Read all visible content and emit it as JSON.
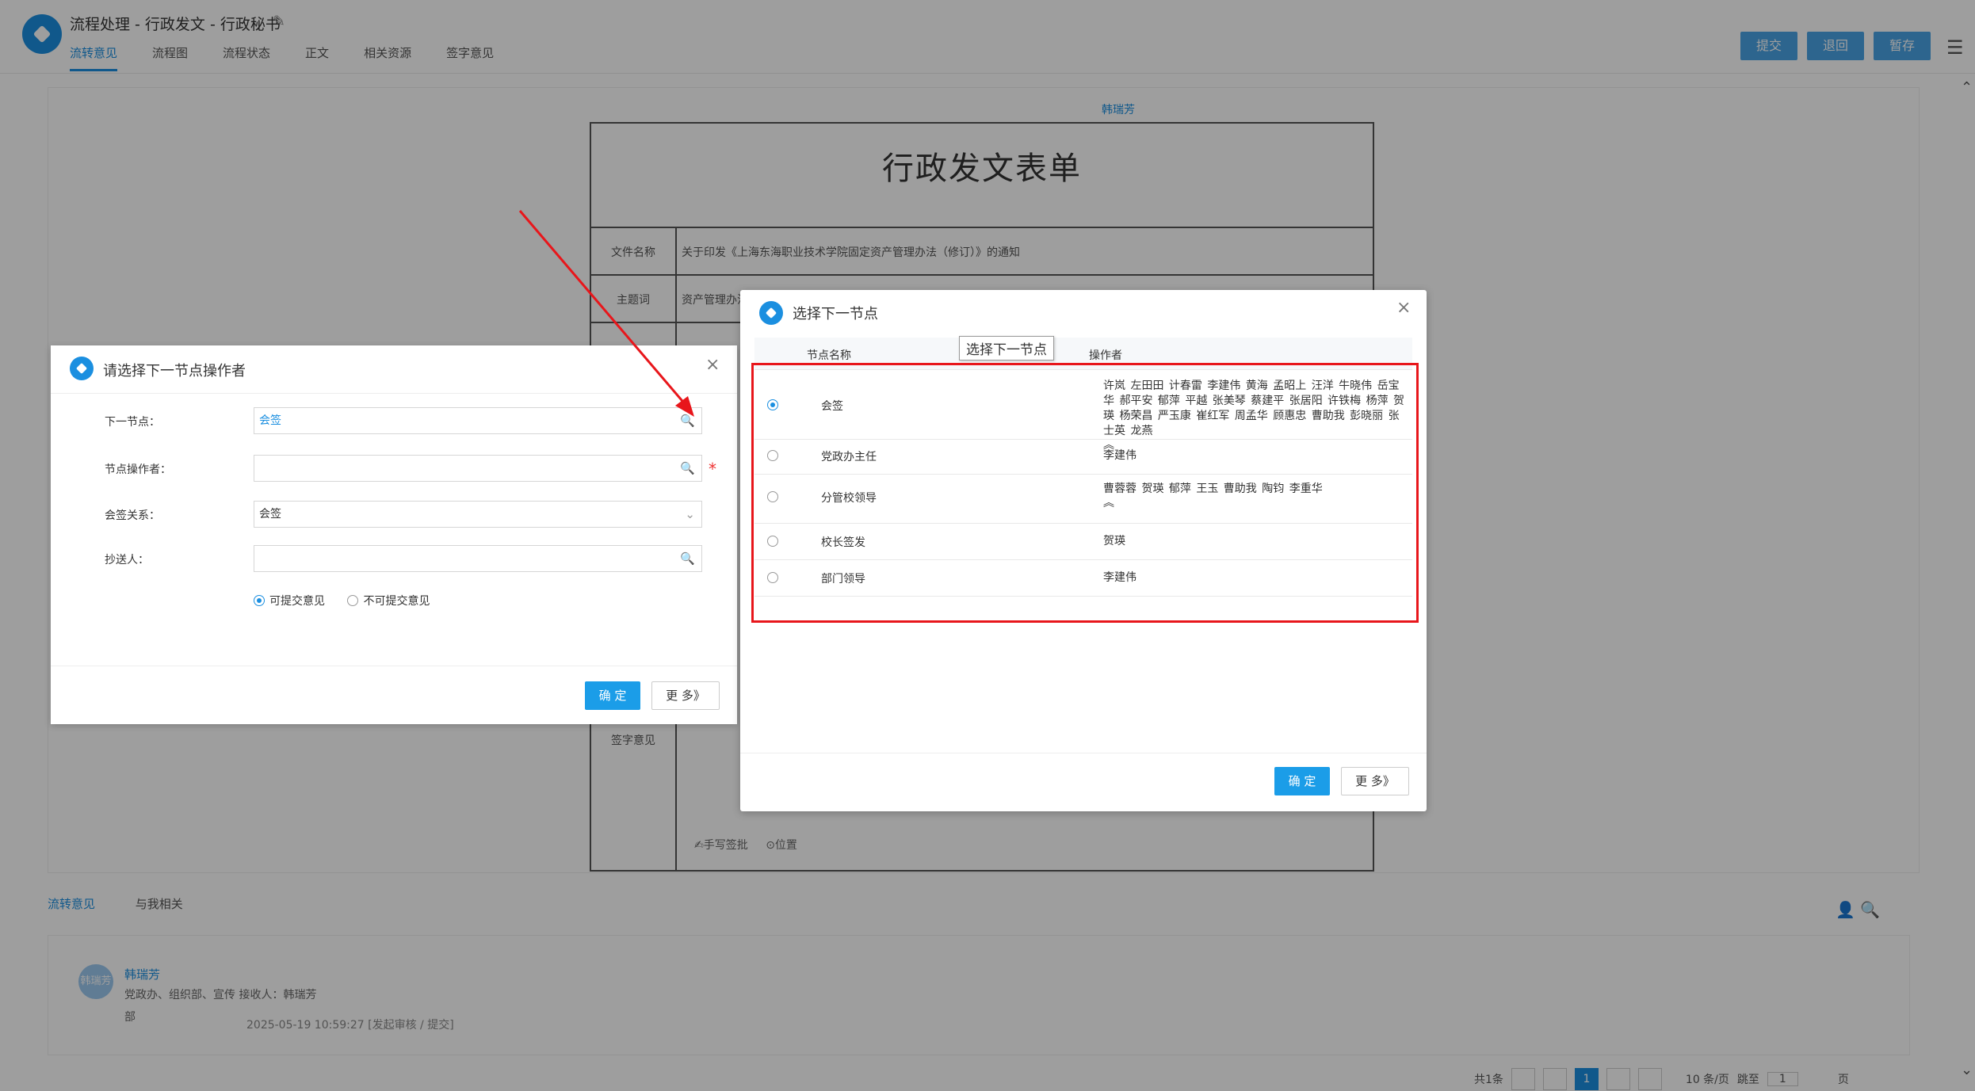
{
  "header": {
    "title": "流程处理 - 行政发文 - 行政秘书",
    "tabs": [
      "流转意见",
      "流程图",
      "流程状态",
      "正文",
      "相关资源",
      "签字意见"
    ],
    "buttons": [
      "提交",
      "退回",
      "暂存"
    ]
  },
  "document": {
    "author": "韩瑞芳",
    "form_title": "行政发文表单",
    "fields": [
      {
        "label": "文件名称",
        "value": "关于印发《上海东海职业技术学院固定资产管理办法（修订）》的通知"
      },
      {
        "label": "主题词",
        "value": "资产管理办法"
      },
      {
        "label": "签字意见",
        "value": ""
      }
    ],
    "signature_tools": [
      "手写签批",
      "位置"
    ]
  },
  "bottom": {
    "tabs": [
      "流转意见",
      "与我相关"
    ],
    "comment": {
      "avatar": "韩瑞芳",
      "name": "韩瑞芳",
      "meta": "党政办、组织部、宣传  接收人：韩瑞芳",
      "meta2": "部",
      "time": "2025-05-19 10:59:27  [发起审核 / 提交]"
    },
    "pager": {
      "total": "共1条",
      "current": "1",
      "per_page": "10 条/页",
      "goto_label": "跳至",
      "goto_value": "1",
      "page_unit": "页"
    }
  },
  "left_dialog": {
    "title": "请选择下一节点操作者",
    "fields": [
      {
        "label": "下一节点：",
        "value": "会签"
      },
      {
        "label": "节点操作者：",
        "value": ""
      },
      {
        "label": "会签关系：",
        "value": "会签"
      },
      {
        "label": "抄送人：",
        "value": ""
      }
    ],
    "options": [
      "可提交意见",
      "不可提交意见"
    ],
    "confirm": "确 定",
    "more": "更 多》"
  },
  "right_dialog": {
    "title": "选择下一节点",
    "tooltip": "选择下一节点",
    "col_name": "节点名称",
    "col_ops": "操作者",
    "rows": [
      {
        "name": "会签",
        "ops": "许岚 左田田 计春雷 李建伟 黄海 孟昭上 汪洋 牛晓伟 岳宝华 郝平安 郁萍 平越 张美琴 蔡建平 张居阳 许铁梅 杨萍 贺瑛 杨荣昌 严玉康 崔红军 周孟华 顾惠忠 曹助我 彭晓丽 张士英 龙燕",
        "selected": true,
        "collapsible": true
      },
      {
        "name": "党政办主任",
        "ops": "李建伟",
        "selected": false,
        "collapsible": false
      },
      {
        "name": "分管校领导",
        "ops": "曹蓉蓉 贺瑛 郁萍 王玉 曹助我 陶钧 李重华",
        "selected": false,
        "collapsible": true
      },
      {
        "name": "校长签发",
        "ops": "贺瑛",
        "selected": false,
        "collapsible": false
      },
      {
        "name": "部门领导",
        "ops": "李建伟",
        "selected": false,
        "collapsible": false
      }
    ],
    "confirm": "确 定",
    "more": "更 多》"
  },
  "colors": {
    "accent": "#1b8fe0",
    "highlight": "#e8161b"
  }
}
